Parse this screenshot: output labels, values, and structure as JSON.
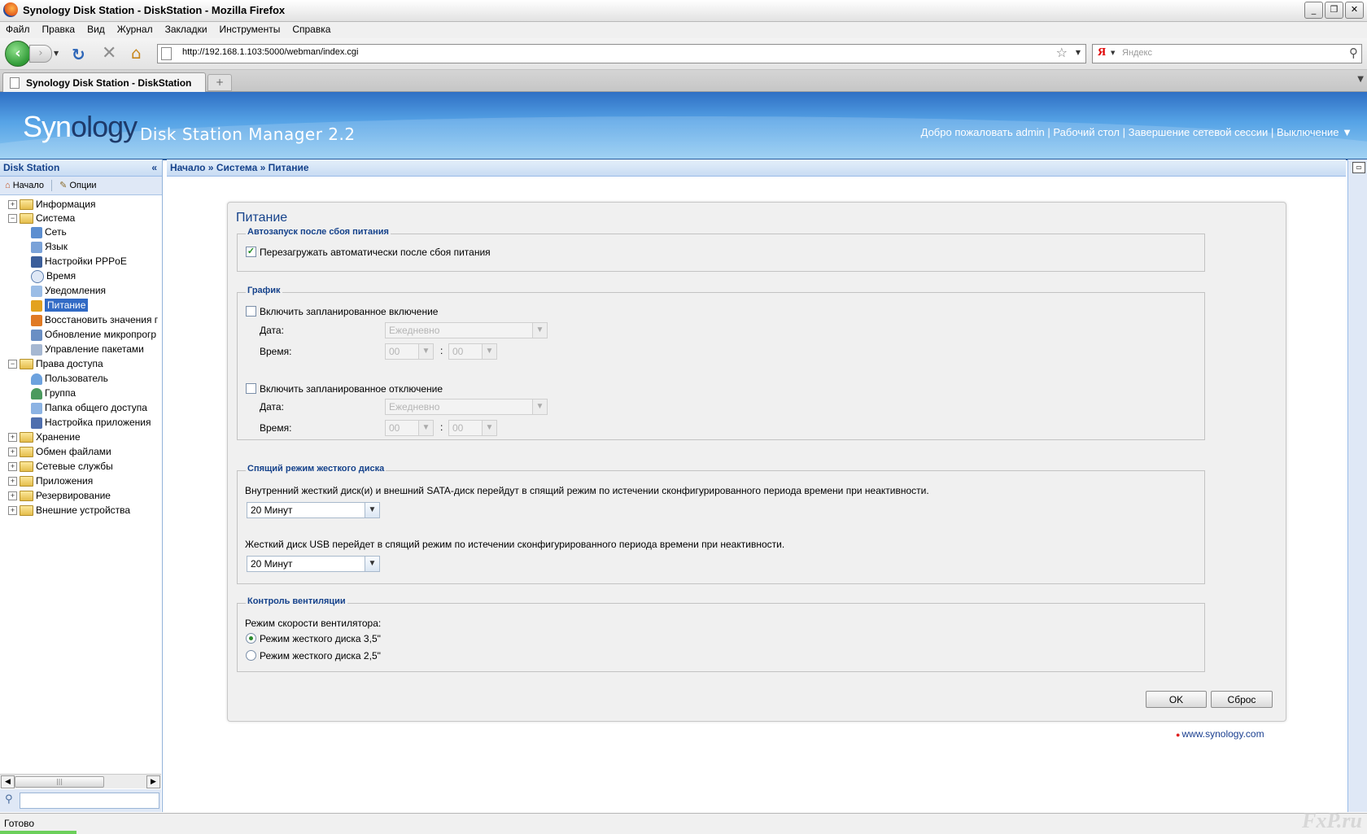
{
  "window": {
    "title": "Synology Disk Station - DiskStation - Mozilla Firefox",
    "minimize": "_",
    "maximize": "❐",
    "close": "✕"
  },
  "menu": [
    "Файл",
    "Правка",
    "Вид",
    "Журнал",
    "Закладки",
    "Инструменты",
    "Справка"
  ],
  "navigation": {
    "url": "http://192.168.1.103:5000/webman/index.cgi",
    "search_placeholder": "Яндекс",
    "search_engine_logo": "Я"
  },
  "tabs": [
    {
      "label": "Synology Disk Station - DiskStation"
    }
  ],
  "header": {
    "logo_syn": "Syn",
    "logo_ology": "ology",
    "product": "Disk Station Manager 2.2",
    "welcome": "Добро пожаловать admin",
    "desktop": "Рабочий стол",
    "logout": "Завершение сетевой сессии",
    "shutdown": "Выключение ▼"
  },
  "sidebar": {
    "title": "Disk Station",
    "collapse": "«",
    "home": "Начало",
    "options": "Опции",
    "tree": [
      {
        "label": "Информация",
        "level": 0,
        "expanded": false
      },
      {
        "label": "Система",
        "level": 0,
        "expanded": true
      },
      {
        "label": "Сеть",
        "level": 1
      },
      {
        "label": "Язык",
        "level": 1
      },
      {
        "label": "Настройки PPPoE",
        "level": 1
      },
      {
        "label": "Время",
        "level": 1
      },
      {
        "label": "Уведомления",
        "level": 1
      },
      {
        "label": "Питание",
        "level": 1,
        "selected": true
      },
      {
        "label": "Восстановить значения г",
        "level": 1
      },
      {
        "label": "Обновление микропрогр",
        "level": 1
      },
      {
        "label": "Управление пакетами",
        "level": 1
      },
      {
        "label": "Права доступа",
        "level": 0,
        "expanded": true
      },
      {
        "label": "Пользователь",
        "level": 1
      },
      {
        "label": "Группа",
        "level": 1
      },
      {
        "label": "Папка общего доступа",
        "level": 1
      },
      {
        "label": "Настройка приложения",
        "level": 1
      },
      {
        "label": "Хранение",
        "level": 0,
        "expanded": false
      },
      {
        "label": "Обмен файлами",
        "level": 0,
        "expanded": false
      },
      {
        "label": "Сетевые службы",
        "level": 0,
        "expanded": false
      },
      {
        "label": "Приложения",
        "level": 0,
        "expanded": false
      },
      {
        "label": "Резервирование",
        "level": 0,
        "expanded": false
      },
      {
        "label": "Внешние устройства",
        "level": 0,
        "expanded": false
      }
    ]
  },
  "breadcrumb": "Начало » Система » Питание",
  "panel": {
    "title": "Питание",
    "autostart": {
      "legend": "Автозапуск после сбоя питания",
      "checkbox": "Перезагружать автоматически после сбоя питания",
      "checked": true
    },
    "schedule": {
      "legend": "График",
      "power_on": "Включить запланированное включение",
      "power_off": "Включить запланированное отключение",
      "date_label": "Дата:",
      "time_label": "Время:",
      "date_value": "Ежедневно",
      "hour": "00",
      "minute": "00",
      "colon": ":"
    },
    "hibernation": {
      "legend": "Спящий режим жесткого диска",
      "internal_text": "Внутренний жесткий диск(и) и внешний SATA-диск перейдут в спящий режим по истечении сконфигурированного периода времени при неактивности.",
      "internal_value": "20 Минут",
      "usb_text": "Жесткий диск USB перейдет в спящий режим по истечении сконфигурированного периода времени при неактивности.",
      "usb_value": "20 Минут"
    },
    "fan": {
      "legend": "Контроль вентиляции",
      "label": "Режим скорости вентилятора:",
      "option1": "Режим жесткого диска 3,5\"",
      "option2": "Режим жесткого диска 2,5\"",
      "selected": 1
    },
    "ok": "OK",
    "reset": "Сброс"
  },
  "footer_link": "www.synology.com",
  "status": "Готово",
  "watermark": "FxP.ru"
}
